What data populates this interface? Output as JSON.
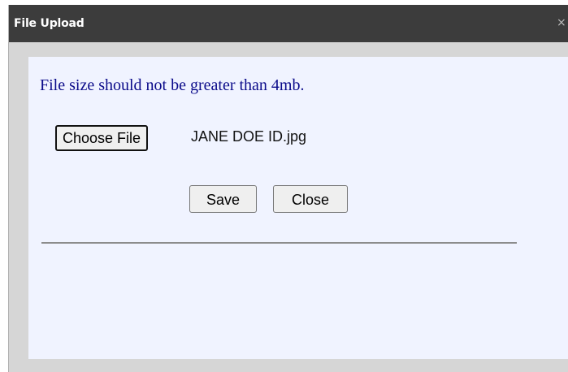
{
  "dialog": {
    "title": "File Upload",
    "close_glyph": "×",
    "notice": "File size should not be greater than 4mb.",
    "file_input": {
      "button_label": "Choose File",
      "selected_file": "JANE DOE ID.jpg"
    },
    "buttons": {
      "save": "Save",
      "close": "Close"
    }
  },
  "colors": {
    "titlebar": "#3c3c3c",
    "content_background": "#f0f3ff",
    "notice_text": "#0b0b8a"
  },
  "icons": {
    "close": "close-icon"
  }
}
